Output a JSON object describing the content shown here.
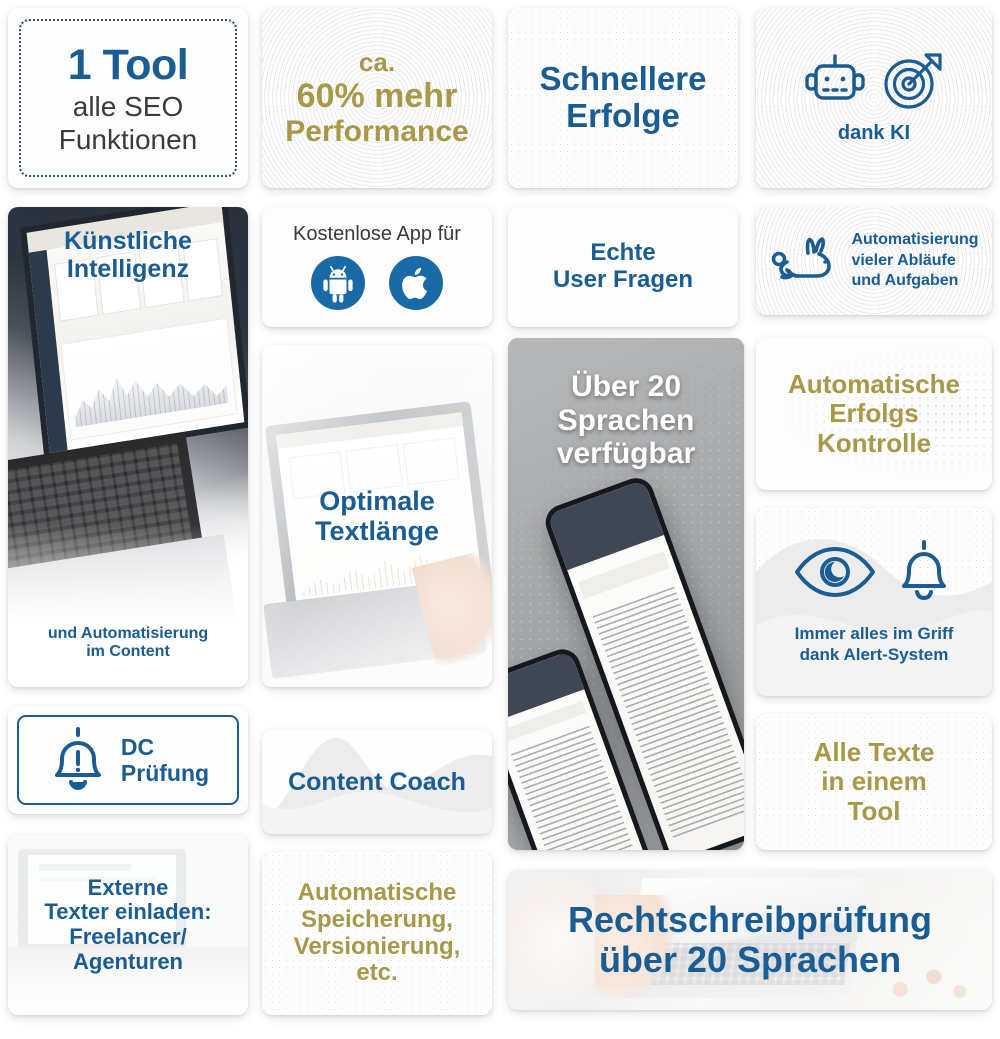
{
  "colors": {
    "blue": "#1a5c94",
    "gold": "#a89948",
    "dark_text": "#3b3b3b",
    "white": "#ffffff",
    "phone_card_bg": "#a9abad"
  },
  "cards": {
    "one_tool": {
      "headline": "1 Tool",
      "line2": "alle SEO",
      "line3": "Funktionen"
    },
    "performance": {
      "line1": "ca.",
      "line2": "60% mehr",
      "line3": "Performance"
    },
    "faster_success": {
      "line1": "Schnellere",
      "line2": "Erfolge"
    },
    "ai_icons": {
      "robot_icon": "robot-icon",
      "target_icon": "target-dart-icon",
      "label": "dank KI"
    },
    "artificial_intelligence": {
      "line1": "Künstliche",
      "line2": "Intelligenz",
      "caption1": "und Automatisierung",
      "caption2": "im Content"
    },
    "free_app": {
      "label": "Kostenlose App für",
      "android_icon": "android-icon",
      "apple_icon": "apple-icon"
    },
    "real_user_questions": {
      "line1": "Echte",
      "line2": "User Fragen"
    },
    "automation": {
      "rabbit_icon": "rabbit-icon",
      "line1": "Automatisierung",
      "line2": "vieler Abläufe",
      "line3": "und Aufgaben"
    },
    "optimal_text_length": {
      "line1": "Optimale",
      "line2": "Textlänge"
    },
    "languages": {
      "line1": "Über 20",
      "line2": "Sprachen",
      "line3": "verfügbar"
    },
    "success_control": {
      "line1": "Automatische",
      "line2": "Erfolgs",
      "line3": "Kontrolle"
    },
    "alert_system": {
      "eye_icon": "eye-icon",
      "bell_icon": "bell-icon",
      "caption1": "Immer alles im Griff",
      "caption2": "dank Alert-System"
    },
    "dc_check": {
      "bell_alert_icon": "bell-alert-icon",
      "line1": "DC",
      "line2": "Prüfung"
    },
    "content_coach": {
      "label": "Content Coach"
    },
    "all_texts": {
      "line1": "Alle Texte",
      "line2": "in einem",
      "line3": "Tool"
    },
    "external_writers": {
      "line1": "Externe",
      "line2": "Texter einladen:",
      "line3": "Freelancer/",
      "line4": "Agenturen"
    },
    "auto_save": {
      "line1": "Automatische",
      "line2": "Speicherung,",
      "line3": "Versionierung,",
      "line4": "etc."
    },
    "spellcheck": {
      "line1": "Rechtschreibprüfung",
      "line2": "über 20 Sprachen"
    }
  }
}
